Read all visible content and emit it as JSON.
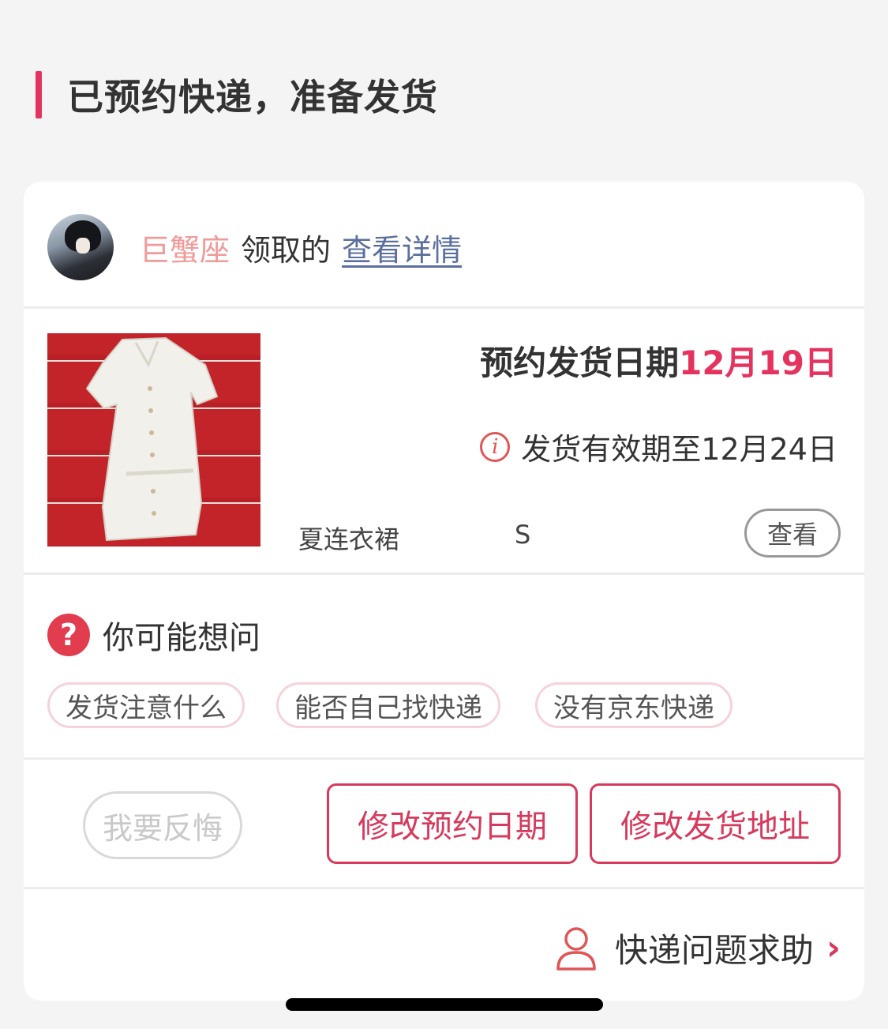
{
  "header": {
    "title": "已预约快递，准备发货"
  },
  "colors": {
    "accent": "#e4335f",
    "link": "#5b6f9e",
    "user_name": "#f09a9a"
  },
  "claim": {
    "user_name": "巨蟹座",
    "claimed_text": "领取的",
    "detail_link": "查看详情"
  },
  "product": {
    "ship_date_label": "预约发货日期",
    "ship_date_value": "12月19日",
    "validity_text": "发货有效期至12月24日",
    "name": "夏连衣裙",
    "size": "S",
    "view_label": "查看"
  },
  "faq": {
    "title": "你可能想问",
    "chips": [
      "发货注意什么",
      "能否自己找快递",
      "没有京东快递"
    ]
  },
  "actions": {
    "regret": "我要反悔",
    "modify_date": "修改预约日期",
    "modify_address": "修改发货地址"
  },
  "help": {
    "label": "快递问题求助"
  }
}
